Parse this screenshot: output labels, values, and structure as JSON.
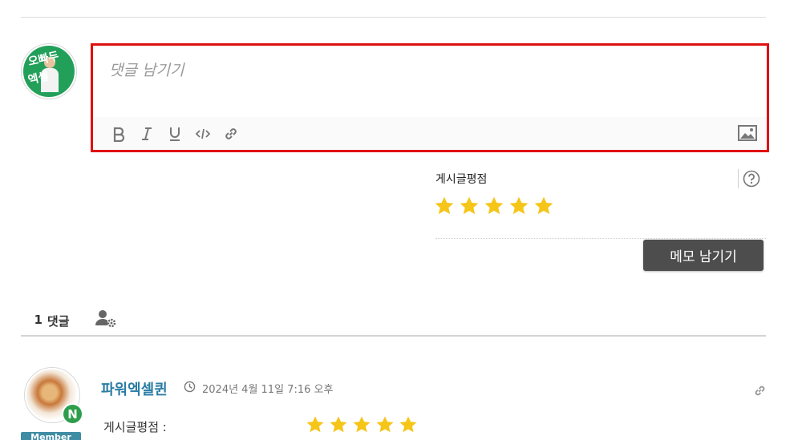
{
  "editor": {
    "placeholder": "댓글 남기기",
    "toolbar": {
      "bold_icon": "bold-icon",
      "italic_icon": "italic-icon",
      "underline_icon": "underline-icon",
      "code_icon": "code-icon",
      "link_icon": "link-icon",
      "image_icon": "image-icon"
    },
    "highlight_color": "#e01010"
  },
  "rating": {
    "label": "게시글평점",
    "stars": 5,
    "star_color": "#f5c518",
    "help_icon": "help-icon"
  },
  "memo_button": {
    "label": "메모 남기기"
  },
  "tabs": {
    "comments_count": "1",
    "comments_label": "댓글",
    "users_icon": "user-settings-icon",
    "active_color": "#2a9d8f"
  },
  "comment": {
    "author": "파워엑셀퀸",
    "date": "2024년 4월 11일 7:16 오후",
    "badge": "N",
    "member_label": "Member",
    "rating_label": "게시글평점 :",
    "stars": 5
  }
}
